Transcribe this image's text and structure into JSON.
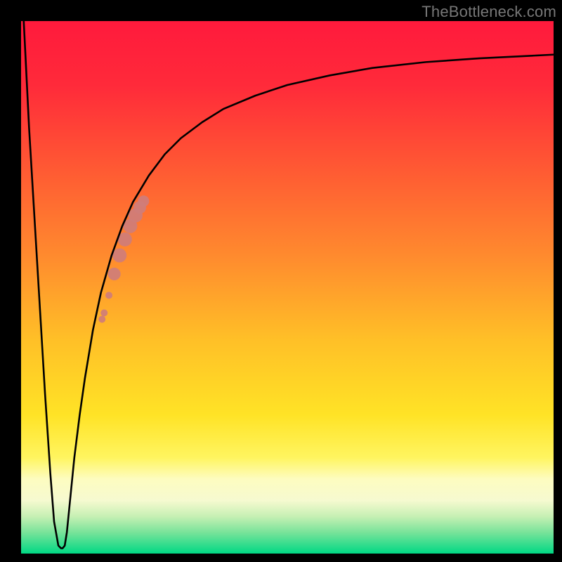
{
  "watermark": {
    "text": "TheBottleneck.com"
  },
  "chart_data": {
    "type": "line",
    "title": "",
    "xlabel": "",
    "ylabel": "",
    "xlim": [
      0,
      100
    ],
    "ylim": [
      0,
      100
    ],
    "gradient_stops": [
      {
        "offset": 0.0,
        "color": "#ff1a3c"
      },
      {
        "offset": 0.12,
        "color": "#ff2a3a"
      },
      {
        "offset": 0.28,
        "color": "#ff5a33"
      },
      {
        "offset": 0.44,
        "color": "#ff8a2e"
      },
      {
        "offset": 0.6,
        "color": "#ffc027"
      },
      {
        "offset": 0.74,
        "color": "#ffe326"
      },
      {
        "offset": 0.82,
        "color": "#fff560"
      },
      {
        "offset": 0.86,
        "color": "#fdfcc0"
      },
      {
        "offset": 0.9,
        "color": "#f6fad0"
      },
      {
        "offset": 0.93,
        "color": "#c7f0b4"
      },
      {
        "offset": 0.96,
        "color": "#79e39a"
      },
      {
        "offset": 1.0,
        "color": "#00d884"
      }
    ],
    "series": [
      {
        "name": "bottleneck-curve",
        "x": [
          0.5,
          1.5,
          3.0,
          4.5,
          5.5,
          6.2,
          7.0,
          7.5,
          7.8,
          8.2,
          8.6,
          9.0,
          9.4,
          10.0,
          11.0,
          12.0,
          13.5,
          15.0,
          17.0,
          19.0,
          21.0,
          24.0,
          27.0,
          30.0,
          34.0,
          38.0,
          44.0,
          50.0,
          58.0,
          66.0,
          76.0,
          86.0,
          96.0,
          100.0
        ],
        "y": [
          100.0,
          80.0,
          55.0,
          30.0,
          15.0,
          6.0,
          1.5,
          1.0,
          1.0,
          1.5,
          4.0,
          8.0,
          12.0,
          18.0,
          26.0,
          33.0,
          42.0,
          49.0,
          56.0,
          61.5,
          66.0,
          71.0,
          75.0,
          78.0,
          81.0,
          83.5,
          86.0,
          88.0,
          89.8,
          91.2,
          92.3,
          93.0,
          93.5,
          93.7
        ]
      }
    ],
    "highlight_points": {
      "name": "highlight-band",
      "color": "#cf7d7a",
      "points": [
        {
          "x": 15.2,
          "y": 44.0,
          "r": 5
        },
        {
          "x": 15.6,
          "y": 45.2,
          "r": 5
        },
        {
          "x": 16.5,
          "y": 48.5,
          "r": 5
        },
        {
          "x": 17.5,
          "y": 52.5,
          "r": 9
        },
        {
          "x": 18.5,
          "y": 56.0,
          "r": 10
        },
        {
          "x": 19.5,
          "y": 59.0,
          "r": 10
        },
        {
          "x": 20.5,
          "y": 61.5,
          "r": 10
        },
        {
          "x": 21.5,
          "y": 63.5,
          "r": 10
        },
        {
          "x": 22.3,
          "y": 65.0,
          "r": 9
        },
        {
          "x": 23.0,
          "y": 66.2,
          "r": 8
        }
      ]
    }
  }
}
